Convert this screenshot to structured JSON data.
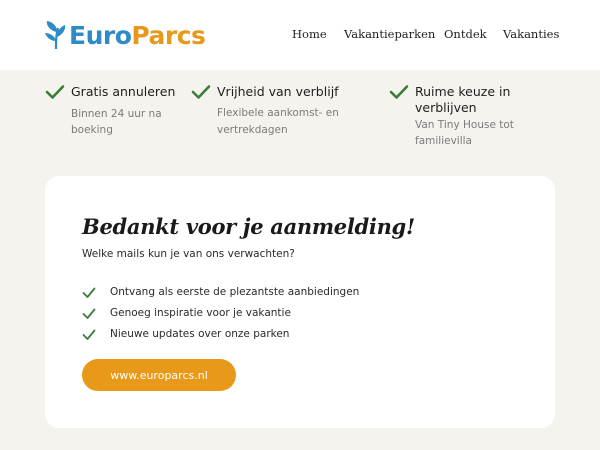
{
  "brand": {
    "logo_part1": "Euro",
    "logo_part2": "Parcs",
    "color_blue": "#2e8bc6",
    "color_orange": "#e8991a"
  },
  "nav": {
    "items": [
      "Home",
      "Vakantieparken",
      "Ontdek",
      "Vakanties"
    ]
  },
  "usps": [
    {
      "icon": "check-icon",
      "title": "Gratis annuleren",
      "subtitle_lines": [
        "Binnen 24 uur na",
        "boeking"
      ]
    },
    {
      "icon": "check-icon",
      "title": "Vrijheid van verblijf",
      "subtitle_lines": [
        "Flexibele aankomst- en",
        "vertrekdagen"
      ]
    },
    {
      "icon": "check-icon",
      "title_lines": [
        "Ruime keuze in",
        "verblijven"
      ],
      "subtitle_lines": [
        "Van Tiny House tot",
        "familievilla"
      ]
    }
  ],
  "confirmation": {
    "title": "Bedankt voor je aanmelding!",
    "intro": "Welke mails kun je van ons verwachten?",
    "benefits": [
      "Ontvang als eerste de plezantste aanbiedingen",
      "Genoeg inspiratie voor je vakantie",
      "Nieuwe updates over onze parken"
    ],
    "button_label": "www.europarcs.nl"
  },
  "colors": {
    "check_green": "#3a7d3a",
    "button_orange": "#e8991a",
    "page_background": "#f5f3ee"
  }
}
